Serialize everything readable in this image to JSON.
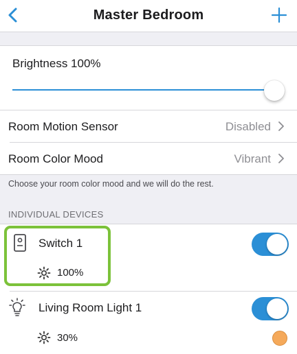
{
  "header": {
    "title": "Master Bedroom",
    "back_icon": "chevron-left-icon",
    "add_icon": "plus-icon",
    "accent_color": "#2b8fd6"
  },
  "brightness": {
    "label": "Brightness 100%",
    "level_percent": 100
  },
  "settings": [
    {
      "label": "Room Motion Sensor",
      "value": "Disabled"
    },
    {
      "label": "Room Color Mood",
      "value": "Vibrant"
    }
  ],
  "hint": "Choose your room color mood and we will do the rest.",
  "section_header": "INDIVIDUAL DEVICES",
  "devices": [
    {
      "name": "Switch 1",
      "icon": "switch-icon",
      "level": "100%",
      "on": true,
      "highlighted": true,
      "highlight_color": "#7cc23a"
    },
    {
      "name": "Living Room Light 1",
      "icon": "light-bulb-icon",
      "level": "30%",
      "on": true,
      "color": "#f5a95a"
    }
  ]
}
